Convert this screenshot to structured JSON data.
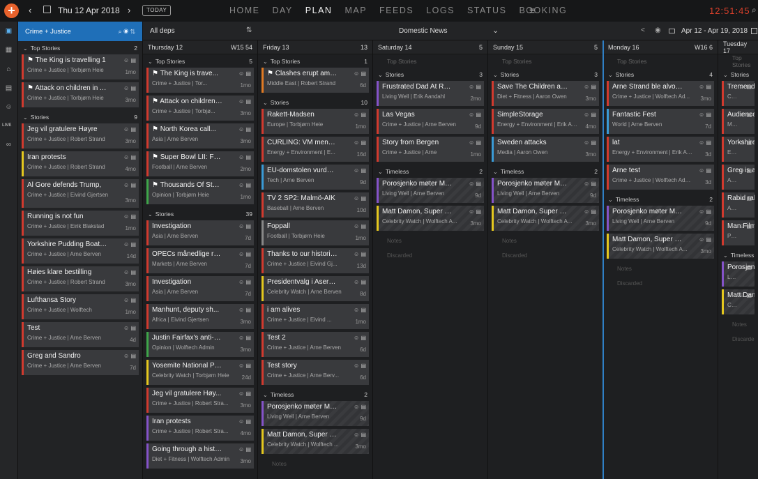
{
  "header": {
    "date": "Thu 12 Apr 2018",
    "today_label": "TODAY",
    "nav": [
      "HOME",
      "DAY",
      "PLAN",
      "MAP",
      "FEEDS",
      "LOGS",
      "STATUS",
      "BOOKING"
    ],
    "active_nav": "PLAN",
    "clock": "12:51:45"
  },
  "desk": {
    "title": "Crime + Justice",
    "top": {
      "label": "Top Stories",
      "count": "2",
      "cards": [
        {
          "t": "The King is travelling 1",
          "s": "Crime + Justice | Torbjørn Heie",
          "a": "1mo",
          "c": "red",
          "flag": true
        },
        {
          "t": "Attack on children in Af...",
          "s": "Crime + Justice | Torbjørn Heie",
          "a": "3mo",
          "c": "red",
          "flag": true
        }
      ]
    },
    "stories": {
      "label": "Stories",
      "count": "9",
      "cards": [
        {
          "t": "Jeg vil gratulere Høyre",
          "s": "Crime + Justice | Robert Strand",
          "a": "3mo",
          "c": "red"
        },
        {
          "t": "Iran protests",
          "s": "Crime + Justice | Robert Strand",
          "a": "4mo",
          "c": "yel"
        },
        {
          "t": "Al Gore defends Trump,",
          "s": "Crime + Justice | Eivind Gjertsen",
          "a": "3mo",
          "c": "red",
          "tall": true
        },
        {
          "t": "Running is not fun",
          "s": "Crime + Justice | Eirik Blakstad",
          "a": "1mo",
          "c": "red"
        },
        {
          "t": "Yorkshire Pudding Boat Race",
          "s": "Crime + Justice | Arne Berven",
          "a": "14d",
          "c": "red"
        },
        {
          "t": "Høies klare bestilling",
          "s": "Crime + Justice | Robert Strand",
          "a": "3mo",
          "c": "red"
        },
        {
          "t": "Lufthansa Story",
          "s": "Crime + Justice | Wolftech",
          "a": "1mo",
          "c": "red"
        },
        {
          "t": "Test",
          "s": "Crime + Justice | Arne Berven",
          "a": "4d",
          "c": "red"
        },
        {
          "t": "Greg and Sandro",
          "s": "Crime + Justice | Arne Berven",
          "a": "7d",
          "c": "red"
        }
      ]
    }
  },
  "toolbar": {
    "deps": "All deps",
    "domestic": "Domestic News",
    "range": "Apr 12 - Apr 19, 2018"
  },
  "columns": [
    {
      "day": "Thursday 12",
      "week": "W15 54",
      "top": {
        "count": "5",
        "cards": [
          {
            "t": "The King is trave...",
            "s": "Crime + Justice | Tor...",
            "a": "1mo",
            "c": "red",
            "flag": true
          },
          {
            "t": "Attack on children i...",
            "s": "Crime + Justice | Torbjø...",
            "a": "3mo",
            "c": "red",
            "flag": true
          },
          {
            "t": "North Korea call...",
            "s": "Asia | Arne Berven",
            "a": "3mo",
            "c": "red",
            "flag": true
          },
          {
            "t": "Super Bowl LII: Foles vs....",
            "s": "Football | Arne Berven",
            "a": "2mo",
            "c": "red",
            "flag": true
          },
          {
            "t": "Thousands Of Studen...",
            "s": "Opinion | Torbjørn Heie",
            "a": "1mo",
            "c": "grn",
            "flag": true
          }
        ]
      },
      "stories": {
        "count": "39",
        "cards": [
          {
            "t": "Investigation",
            "s": "Asia | Arne Berven",
            "a": "7d",
            "c": "red"
          },
          {
            "t": "OPECs månedlige rapport leg...",
            "s": "Markets | Arne Berven",
            "a": "7d",
            "c": "red"
          },
          {
            "t": "Investigation",
            "s": "Asia | Arne Berven",
            "a": "7d",
            "c": "red"
          },
          {
            "t": "Manhunt, deputy sh...",
            "s": "Africa | Eivind Gjertsen",
            "a": "3mo",
            "c": "red"
          },
          {
            "t": "Justin Fairfax's anti-Conf...",
            "s": "Opinion | Wolftech Admin",
            "a": "3mo",
            "c": "grn"
          },
          {
            "t": "Yosemite National Park Co...",
            "s": "Celebrity Watch | Torbjørn Heie",
            "a": "24d",
            "c": "yel"
          },
          {
            "t": "Jeg vil gratulere Høy...",
            "s": "Crime + Justice | Robert Stra...",
            "a": "3mo",
            "c": "red"
          },
          {
            "t": "Iran protests",
            "s": "Crime + Justice | Robert Stra...",
            "a": "4mo",
            "c": "pur"
          },
          {
            "t": "Going through a historic",
            "s": "Diet + Fitness | Wolftech Admin",
            "a": "3mo",
            "c": "pur"
          }
        ]
      }
    },
    {
      "day": "Friday 13",
      "week": "13",
      "top": {
        "count": "1",
        "cards": [
          {
            "t": "Clashes erupt amid fresh ...",
            "s": "Middle East | Robert Strand",
            "a": "6d",
            "c": "org",
            "flag": true
          }
        ]
      },
      "stories": {
        "count": "10",
        "cards": [
          {
            "t": "Rakett-Madsen",
            "s": "Europe | Torbjørn Heie",
            "a": "1mo",
            "c": "red"
          },
          {
            "t": "CURLING: VM menn i Las Veg...",
            "s": "Energy + Environment | E...",
            "a": "16d",
            "c": "red"
          },
          {
            "t": "EU-domstolen vurderer Uber-...",
            "s": "Tech | Arne Berven",
            "a": "9d",
            "c": "blu"
          },
          {
            "t": "TV 2 SP2: Malmö-AIK",
            "s": "Baseball | Arne Berven",
            "a": "10d",
            "c": "red"
          },
          {
            "t": "Foppall",
            "s": "Football | Torbjørn Heie",
            "a": "1mo",
            "c": "gry"
          },
          {
            "t": "Thanks to our historic TAX ...",
            "s": "Crime + Justice | Eivind Gj...",
            "a": "13d",
            "c": "red"
          },
          {
            "t": "Presidentvalg i Aserbajdsjan",
            "s": "Celebrity Watch | Arne Berven",
            "a": "8d",
            "c": "yel"
          },
          {
            "t": "i am alives",
            "s": "Crime + Justice | Eivind ...",
            "a": "1mo",
            "c": "red"
          },
          {
            "t": "Test 2",
            "s": "Crime + Justice | Arne Berven",
            "a": "6d",
            "c": "red"
          },
          {
            "t": "Test story",
            "s": "Crime + Justice | Arne Berv...",
            "a": "6d",
            "c": "red"
          }
        ]
      },
      "timeless": {
        "count": "2",
        "cards": [
          {
            "t": "Porosjenko møter Merkel i Be...",
            "s": "Living Well | Arne Berven",
            "a": "9d",
            "c": "pur"
          },
          {
            "t": "Matt Damon, Super Bowl",
            "s": "Celebrity Watch | Wolftech ...",
            "a": "3mo",
            "c": "yel"
          }
        ]
      },
      "ghosts": [
        "Notes"
      ]
    },
    {
      "day": "Saturday 14",
      "week": "5",
      "stories": {
        "count": "3",
        "cards": [
          {
            "t": "Frustrated Dad At Restaura...",
            "s": "Living Well | Erik Aandahl",
            "a": "2mo",
            "c": "pur"
          },
          {
            "t": "Las Vegas",
            "s": "Crime + Justice | Arne Berven",
            "a": "9d",
            "c": "red"
          },
          {
            "t": "Story from Bergen",
            "s": "Crime + Justice | Arne",
            "a": "1mo",
            "c": "red"
          }
        ]
      },
      "timeless": {
        "count": "2",
        "cards": [
          {
            "t": "Porosjenko møter Merkel i Ber...",
            "s": "Living Well | Arne Berven",
            "a": "9d",
            "c": "pur"
          },
          {
            "t": "Matt Damon, Super Bowl",
            "s": "Celebrity Watch | Wolftech A...",
            "a": "3mo",
            "c": "yel"
          }
        ]
      },
      "ghosts": [
        "Notes",
        "Discarded"
      ]
    },
    {
      "day": "Sunday 15",
      "week": "5",
      "stories": {
        "count": "3",
        "cards": [
          {
            "t": "Save The Children at...",
            "s": "Diet + Fitness | Aaron Owen",
            "a": "3mo",
            "c": "red"
          },
          {
            "t": "SimpleStorage",
            "s": "Energy + Environment | Erik Aan...",
            "a": "4mo",
            "c": "red"
          },
          {
            "t": "Sweden attacks",
            "s": "Media | Aaron Owen",
            "a": "3mo",
            "c": "blu"
          }
        ]
      },
      "timeless": {
        "count": "2",
        "cards": [
          {
            "t": "Porosjenko møter Merkel i Ber...",
            "s": "Living Well | Arne Berven",
            "a": "9d",
            "c": "pur"
          },
          {
            "t": "Matt Damon, Super Bowl",
            "s": "Celebrity Watch | Wolftech A...",
            "a": "3mo",
            "c": "yel"
          }
        ]
      },
      "ghosts": [
        "Notes",
        "Discarded"
      ]
    },
    {
      "day": "Monday 16",
      "week": "W16 6",
      "stories": {
        "count": "4",
        "cards": [
          {
            "t": "Arne Strand ble alvorlig s...",
            "s": "Crime + Justice | Wolftech Ad...",
            "a": "3mo",
            "c": "red"
          },
          {
            "t": "Fantastic Fest",
            "s": "World | Arne Berven",
            "a": "7d",
            "c": "blu"
          },
          {
            "t": "lat",
            "s": "Energy + Environment | Erik Aanda...",
            "a": "3d",
            "c": "red"
          },
          {
            "t": "Arne test",
            "s": "Crime + Justice | Wolftech Admin",
            "a": "3d",
            "c": "red"
          }
        ]
      },
      "timeless": {
        "count": "2",
        "cards": [
          {
            "t": "Porosjenko møter Merkel i Ber...",
            "s": "Living Well | Arne Berven",
            "a": "9d",
            "c": "pur"
          },
          {
            "t": "Matt Damon, Super Bowl",
            "s": "Celebrity Watch | Wolftech A...",
            "a": "3mo",
            "c": "yel"
          }
        ]
      },
      "ghosts": [
        "Notes",
        "Discarded"
      ]
    },
    {
      "day": "Tuesday 17",
      "week": "",
      "stories": {
        "count": "",
        "cards": [
          {
            "t": "Tremendo",
            "s": "Crime + J",
            "a": "",
            "c": "red"
          },
          {
            "t": "Audience I",
            "s": "Movie",
            "a": "",
            "c": "red"
          },
          {
            "t": "Yorkshire",
            "s": "Energy +",
            "a": "",
            "c": "red"
          },
          {
            "t": "Greg is a g",
            "s": "Africa",
            "a": "",
            "c": "red"
          },
          {
            "t": "Rabid rabb",
            "s": "Africa",
            "a": "",
            "c": "red"
          },
          {
            "t": "Man Filmin",
            "s": "Parenting +",
            "a": "",
            "c": "red"
          }
        ]
      },
      "timeless": {
        "count": "",
        "cards": [
          {
            "t": "Porosjenko",
            "s": "Living Well |",
            "a": "",
            "c": "pur"
          },
          {
            "t": "Matt Damo",
            "s": "Celebrit",
            "a": "",
            "c": "yel"
          }
        ]
      },
      "ghosts": [
        "Notes",
        "Discarde"
      ]
    }
  ],
  "labels": {
    "top_stories": "Top Stories",
    "stories": "Stories",
    "timeless": "Timeless",
    "live": "LIVE"
  }
}
